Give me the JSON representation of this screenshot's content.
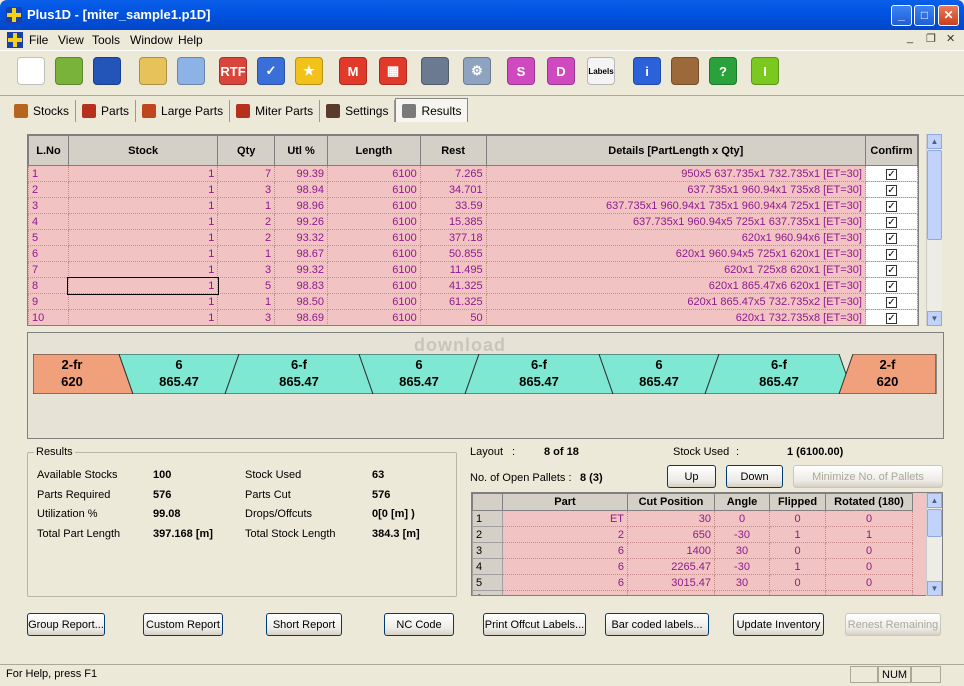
{
  "window": {
    "title": "Plus1D - [miter_sample1.p1D]"
  },
  "menu": [
    "File",
    "View",
    "Tools",
    "Window",
    "Help"
  ],
  "toolbar": [
    {
      "name": "new-icon",
      "glyph": "",
      "color": "#ffffff"
    },
    {
      "name": "open-icon",
      "glyph": "",
      "color": "#7ab33a"
    },
    {
      "name": "save-icon",
      "glyph": "",
      "color": "#2354b8"
    },
    {
      "name": "lock-document-icon",
      "glyph": "",
      "color": "#e7c25a"
    },
    {
      "name": "palette-icon",
      "glyph": "",
      "color": "#8db2e6"
    },
    {
      "name": "rtf-report-icon",
      "glyph": "RTF",
      "color": "#d9453a"
    },
    {
      "name": "checklist-icon",
      "glyph": "✓",
      "color": "#3a6fd8"
    },
    {
      "name": "star-icon",
      "glyph": "★",
      "color": "#f2c21b"
    },
    {
      "name": "miter-m-icon",
      "glyph": "M",
      "color": "#e23a2a"
    },
    {
      "name": "grid-layout-icon",
      "glyph": "▦",
      "color": "#e23a2a"
    },
    {
      "name": "pointer-icon",
      "glyph": "",
      "color": "#6b7a90"
    },
    {
      "name": "gear-run-icon",
      "glyph": "⚙",
      "color": "#8ea3bf"
    },
    {
      "name": "stock-doc-icon",
      "glyph": "S",
      "color": "#d04abf"
    },
    {
      "name": "add-doc-icon",
      "glyph": "D",
      "color": "#d04abf"
    },
    {
      "name": "labels-icon",
      "glyph": "Labels",
      "color": "#8c8c8c"
    },
    {
      "name": "info-icon",
      "glyph": "i",
      "color": "#2b62d9"
    },
    {
      "name": "film-icon",
      "glyph": "",
      "color": "#9c6a3a"
    },
    {
      "name": "help-icon",
      "glyph": "?",
      "color": "#2aa13a"
    },
    {
      "name": "edge-icon",
      "glyph": "I",
      "color": "#7ac820"
    }
  ],
  "tabs": [
    {
      "label": "Stocks",
      "name": "tab-stocks",
      "color": "#b5651d"
    },
    {
      "label": "Parts",
      "name": "tab-parts",
      "color": "#b5301d"
    },
    {
      "label": "Large Parts",
      "name": "tab-large-parts",
      "color": "#c0441d"
    },
    {
      "label": "Miter Parts",
      "name": "tab-miter-parts",
      "color": "#b5301d"
    },
    {
      "label": "Settings",
      "name": "tab-settings",
      "color": "#5a3a2a"
    },
    {
      "label": "Results",
      "name": "tab-results",
      "color": "#7a7a7a",
      "active": true
    }
  ],
  "grid": {
    "headers": [
      "L.No",
      "Stock",
      "Qty",
      "Utl %",
      "Length",
      "Rest",
      "Details [PartLength x Qty]",
      "Confirm"
    ],
    "rows": [
      [
        "1",
        "1",
        "7",
        "99.39",
        "6100",
        "7.265",
        "950x5    637.735x1    732.735x1    [ET=30]"
      ],
      [
        "2",
        "1",
        "3",
        "98.94",
        "6100",
        "34.701",
        "637.735x1    960.94x1    735x8    [ET=30]"
      ],
      [
        "3",
        "1",
        "1",
        "98.96",
        "6100",
        "33.59",
        "637.735x1    960.94x1    735x1    960.94x4    725x1    [ET=30]"
      ],
      [
        "4",
        "1",
        "2",
        "99.26",
        "6100",
        "15.385",
        "637.735x1    960.94x5    725x1    637.735x1    [ET=30]"
      ],
      [
        "5",
        "1",
        "2",
        "93.32",
        "6100",
        "377.18",
        "620x1    960.94x6    [ET=30]"
      ],
      [
        "6",
        "1",
        "1",
        "98.67",
        "6100",
        "50.855",
        "620x1    960.94x5    725x1    620x1    [ET=30]"
      ],
      [
        "7",
        "1",
        "3",
        "99.32",
        "6100",
        "11.495",
        "620x1    725x8    620x1    [ET=30]"
      ],
      [
        "8",
        "1",
        "5",
        "98.83",
        "6100",
        "41.325",
        "620x1    865.47x6    620x1    [ET=30]"
      ],
      [
        "9",
        "1",
        "1",
        "98.50",
        "6100",
        "61.325",
        "620x1    865.47x5    732.735x2    [ET=30]"
      ],
      [
        "10",
        "1",
        "3",
        "98.69",
        "6100",
        "50",
        "620x1    732.735x8    [ET=30]"
      ]
    ]
  },
  "watermark": "download",
  "layout_strip": [
    {
      "top": "2-fr",
      "bottom": "620",
      "color": "#f0a07a"
    },
    {
      "top": "6",
      "bottom": "865.47",
      "color": "#7ee8d3"
    },
    {
      "top": "6-f",
      "bottom": "865.47",
      "color": "#7ee8d3"
    },
    {
      "top": "6",
      "bottom": "865.47",
      "color": "#7ee8d3"
    },
    {
      "top": "6-f",
      "bottom": "865.47",
      "color": "#7ee8d3"
    },
    {
      "top": "6",
      "bottom": "865.47",
      "color": "#7ee8d3"
    },
    {
      "top": "6-f",
      "bottom": "865.47",
      "color": "#7ee8d3"
    },
    {
      "top": "2-f",
      "bottom": "620",
      "color": "#f0a07a"
    }
  ],
  "results": {
    "title": "Results",
    "left": [
      {
        "label": "Available Stocks",
        "value": "100"
      },
      {
        "label": "Parts Required",
        "value": "576"
      },
      {
        "label": "Utilization %",
        "value": "99.08"
      },
      {
        "label": "Total Part Length",
        "value": "397.168 [m]"
      }
    ],
    "right": [
      {
        "label": "Stock Used",
        "value": "63"
      },
      {
        "label": "Parts Cut",
        "value": "576"
      },
      {
        "label": "Drops/Offcuts",
        "value": "0[0 [m] )"
      },
      {
        "label": "Total Stock Length",
        "value": "384.3 [m]"
      }
    ]
  },
  "layout_info": {
    "layout_label": "Layout",
    "layout_sep": ":",
    "layout_value": "8 of 18",
    "stock_used_label": "Stock Used",
    "stock_used_sep": ":",
    "stock_used_value": "1 (6100.00)",
    "pallets_label": "No. of Open Pallets :",
    "pallets_value": "8 (3)",
    "up": "Up",
    "down": "Down",
    "minimize": "Minimize No. of Pallets"
  },
  "part_grid": {
    "headers": [
      "",
      "Part",
      "Cut Position",
      "Angle",
      "Flipped",
      "Rotated (180)"
    ],
    "rows": [
      [
        "1",
        "ET",
        "30",
        "0",
        "0",
        "0"
      ],
      [
        "2",
        "2",
        "650",
        "-30",
        "1",
        "1"
      ],
      [
        "3",
        "6",
        "1400",
        "30",
        "0",
        "0"
      ],
      [
        "4",
        "6",
        "2265.47",
        "-30",
        "1",
        "0"
      ],
      [
        "5",
        "6",
        "3015.47",
        "30",
        "0",
        "0"
      ],
      [
        "6",
        "",
        "",
        "",
        "",
        ""
      ]
    ]
  },
  "buttons": [
    {
      "label": "Group Report...",
      "name": "group-report-button"
    },
    {
      "label": "Custom Report",
      "name": "custom-report-button"
    },
    {
      "label": "Short Report",
      "name": "short-report-button"
    },
    {
      "label": "NC Code",
      "name": "nc-code-button"
    },
    {
      "label": "Print Offcut Labels...",
      "name": "print-offcut-labels-button"
    },
    {
      "label": "Bar coded labels...",
      "name": "bar-coded-labels-button"
    },
    {
      "label": "Update Inventory",
      "name": "update-inventory-button"
    },
    {
      "label": "Renest Remaining",
      "name": "renest-remaining-button",
      "disabled": true
    }
  ],
  "status": {
    "help": "For Help, press F1",
    "num": "NUM"
  }
}
